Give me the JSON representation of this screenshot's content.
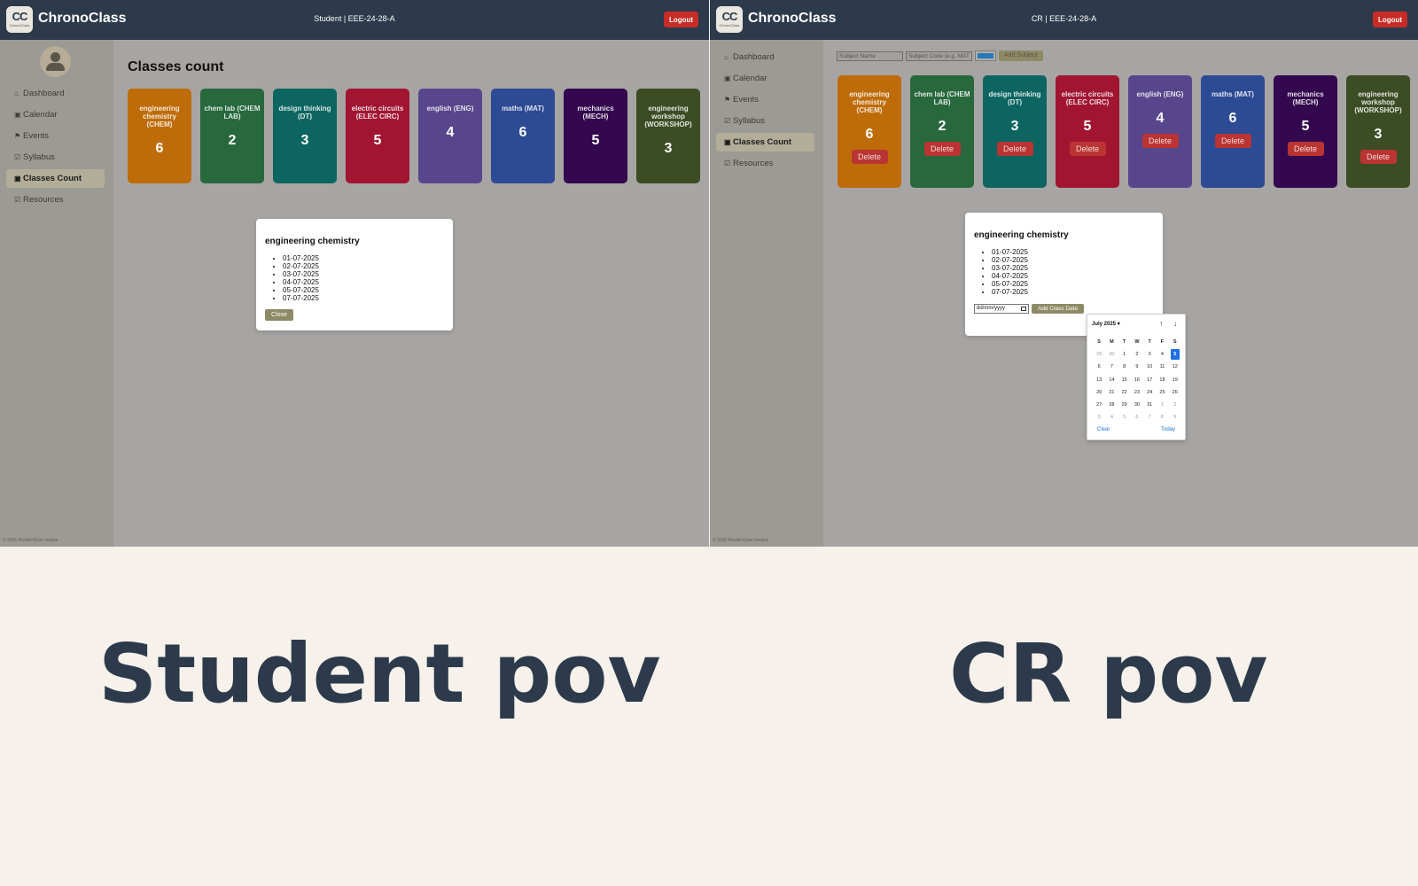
{
  "brand": {
    "logo_text": "CC",
    "logo_subtext": "ChronoClass",
    "name": "ChronoClass"
  },
  "student": {
    "nav_center": "Student | EEE-24-28-A",
    "logout_label": "Logout",
    "menu": [
      {
        "label": "Dashboard",
        "icon": "home-icon"
      },
      {
        "label": "Calendar",
        "icon": "calendar-icon"
      },
      {
        "label": "Events",
        "icon": "flag-icon"
      },
      {
        "label": "Syllabus",
        "icon": "edit-icon"
      },
      {
        "label": "Classes Count",
        "icon": "calendar-icon"
      },
      {
        "label": "Resources",
        "icon": "edit-icon"
      }
    ],
    "page_title": "Classes count",
    "footer": "© 2025 Revelli Kiran Venkat",
    "modal": {
      "title": "engineering chemistry",
      "dates": [
        "01-07-2025",
        "02-07-2025",
        "03-07-2025",
        "04-07-2025",
        "05-07-2025",
        "07-07-2025"
      ],
      "close_label": "Close"
    }
  },
  "cr": {
    "nav_center": "CR | EEE-24-28-A",
    "logout_label": "Logout",
    "menu": [
      {
        "label": "Dashboard",
        "icon": "home-icon"
      },
      {
        "label": "Calendar",
        "icon": "calendar-icon"
      },
      {
        "label": "Events",
        "icon": "flag-icon"
      },
      {
        "label": "Syllabus",
        "icon": "edit-icon"
      },
      {
        "label": "Classes Count",
        "icon": "calendar-icon"
      },
      {
        "label": "Resources",
        "icon": "edit-icon"
      }
    ],
    "footer": "© 2025 Revelli Kiran Venkat",
    "form": {
      "subject_name_placeholder": "Subject Name",
      "subject_code_placeholder": "Subject Code (e.g. MAT",
      "color_value": "#2778b8",
      "add_subject_label": "Add Subject"
    },
    "delete_label": "Delete",
    "modal": {
      "title": "engineering chemistry",
      "dates": [
        "01-07-2025",
        "02-07-2025",
        "03-07-2025",
        "04-07-2025",
        "05-07-2025",
        "07-07-2025"
      ],
      "date_input_value": "dd/mm/yyyy",
      "add_date_label": "Add Class Date"
    },
    "datepicker": {
      "month_label": "July 2025",
      "weekdays": [
        "S",
        "M",
        "T",
        "W",
        "T",
        "F",
        "S"
      ],
      "weeks": [
        [
          "29",
          "30",
          "1",
          "2",
          "3",
          "4",
          "5"
        ],
        [
          "6",
          "7",
          "8",
          "9",
          "10",
          "11",
          "12"
        ],
        [
          "13",
          "14",
          "15",
          "16",
          "17",
          "18",
          "19"
        ],
        [
          "20",
          "21",
          "22",
          "23",
          "24",
          "25",
          "26"
        ],
        [
          "27",
          "28",
          "29",
          "30",
          "31",
          "1",
          "2"
        ],
        [
          "3",
          "4",
          "5",
          "6",
          "7",
          "8",
          "9"
        ]
      ],
      "selected_day": "5",
      "clear_label": "Clear",
      "today_label": "Today"
    }
  },
  "subjects": [
    {
      "name": "engineering chemistry (CHEM)",
      "count": "6",
      "color": "#be6c09"
    },
    {
      "name": "chem lab (CHEM LAB)",
      "count": "2",
      "color": "#27683d"
    },
    {
      "name": "design thinking (DT)",
      "count": "3",
      "color": "#0c6561"
    },
    {
      "name": "electric circuits (ELEC CIRC)",
      "count": "5",
      "color": "#a11531"
    },
    {
      "name": "english (ENG)",
      "count": "4",
      "color": "#57468c"
    },
    {
      "name": "maths (MAT)",
      "count": "6",
      "color": "#2d4a94"
    },
    {
      "name": "mechanics (MECH)",
      "count": "5",
      "color": "#33084e"
    },
    {
      "name": "engineering workshop (WORKSHOP)",
      "count": "3",
      "color": "#3c4c24"
    }
  ],
  "captions": {
    "student": "Student pov",
    "cr": "CR pov"
  }
}
